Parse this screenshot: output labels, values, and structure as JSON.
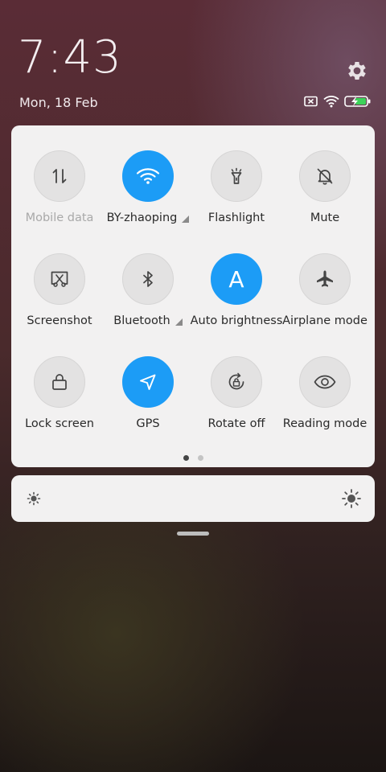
{
  "header": {
    "time": "7:43",
    "date": "Mon, 18 Feb"
  },
  "status_icons": [
    "no-sim-icon",
    "wifi-icon",
    "battery-charging-icon"
  ],
  "tiles": [
    {
      "label": "Mobile data",
      "icon": "mobile-data-icon",
      "active": false,
      "disabled": true
    },
    {
      "label": "BY-zhaoping",
      "icon": "wifi-icon",
      "active": true,
      "expandable": true
    },
    {
      "label": "Flashlight",
      "icon": "flashlight-icon",
      "active": false
    },
    {
      "label": "Mute",
      "icon": "mute-bell-icon",
      "active": false
    },
    {
      "label": "Screenshot",
      "icon": "screenshot-icon",
      "active": false
    },
    {
      "label": "Bluetooth",
      "icon": "bluetooth-icon",
      "active": false,
      "expandable": true
    },
    {
      "label": "Auto brightness",
      "icon": "auto-brightness-icon",
      "icon_text": "A",
      "active": true
    },
    {
      "label": "Airplane mode",
      "icon": "airplane-icon",
      "active": false
    },
    {
      "label": "Lock screen",
      "icon": "lock-icon",
      "active": false
    },
    {
      "label": "GPS",
      "icon": "gps-icon",
      "active": true
    },
    {
      "label": "Rotate off",
      "icon": "rotate-lock-icon",
      "active": false
    },
    {
      "label": "Reading mode",
      "icon": "eye-icon",
      "active": false
    }
  ],
  "pager": {
    "pages": 2,
    "current": 1
  },
  "colors": {
    "active": "#1c9cf6",
    "tile_bg": "#e3e2e2",
    "panel_bg": "#f2f1f1"
  }
}
